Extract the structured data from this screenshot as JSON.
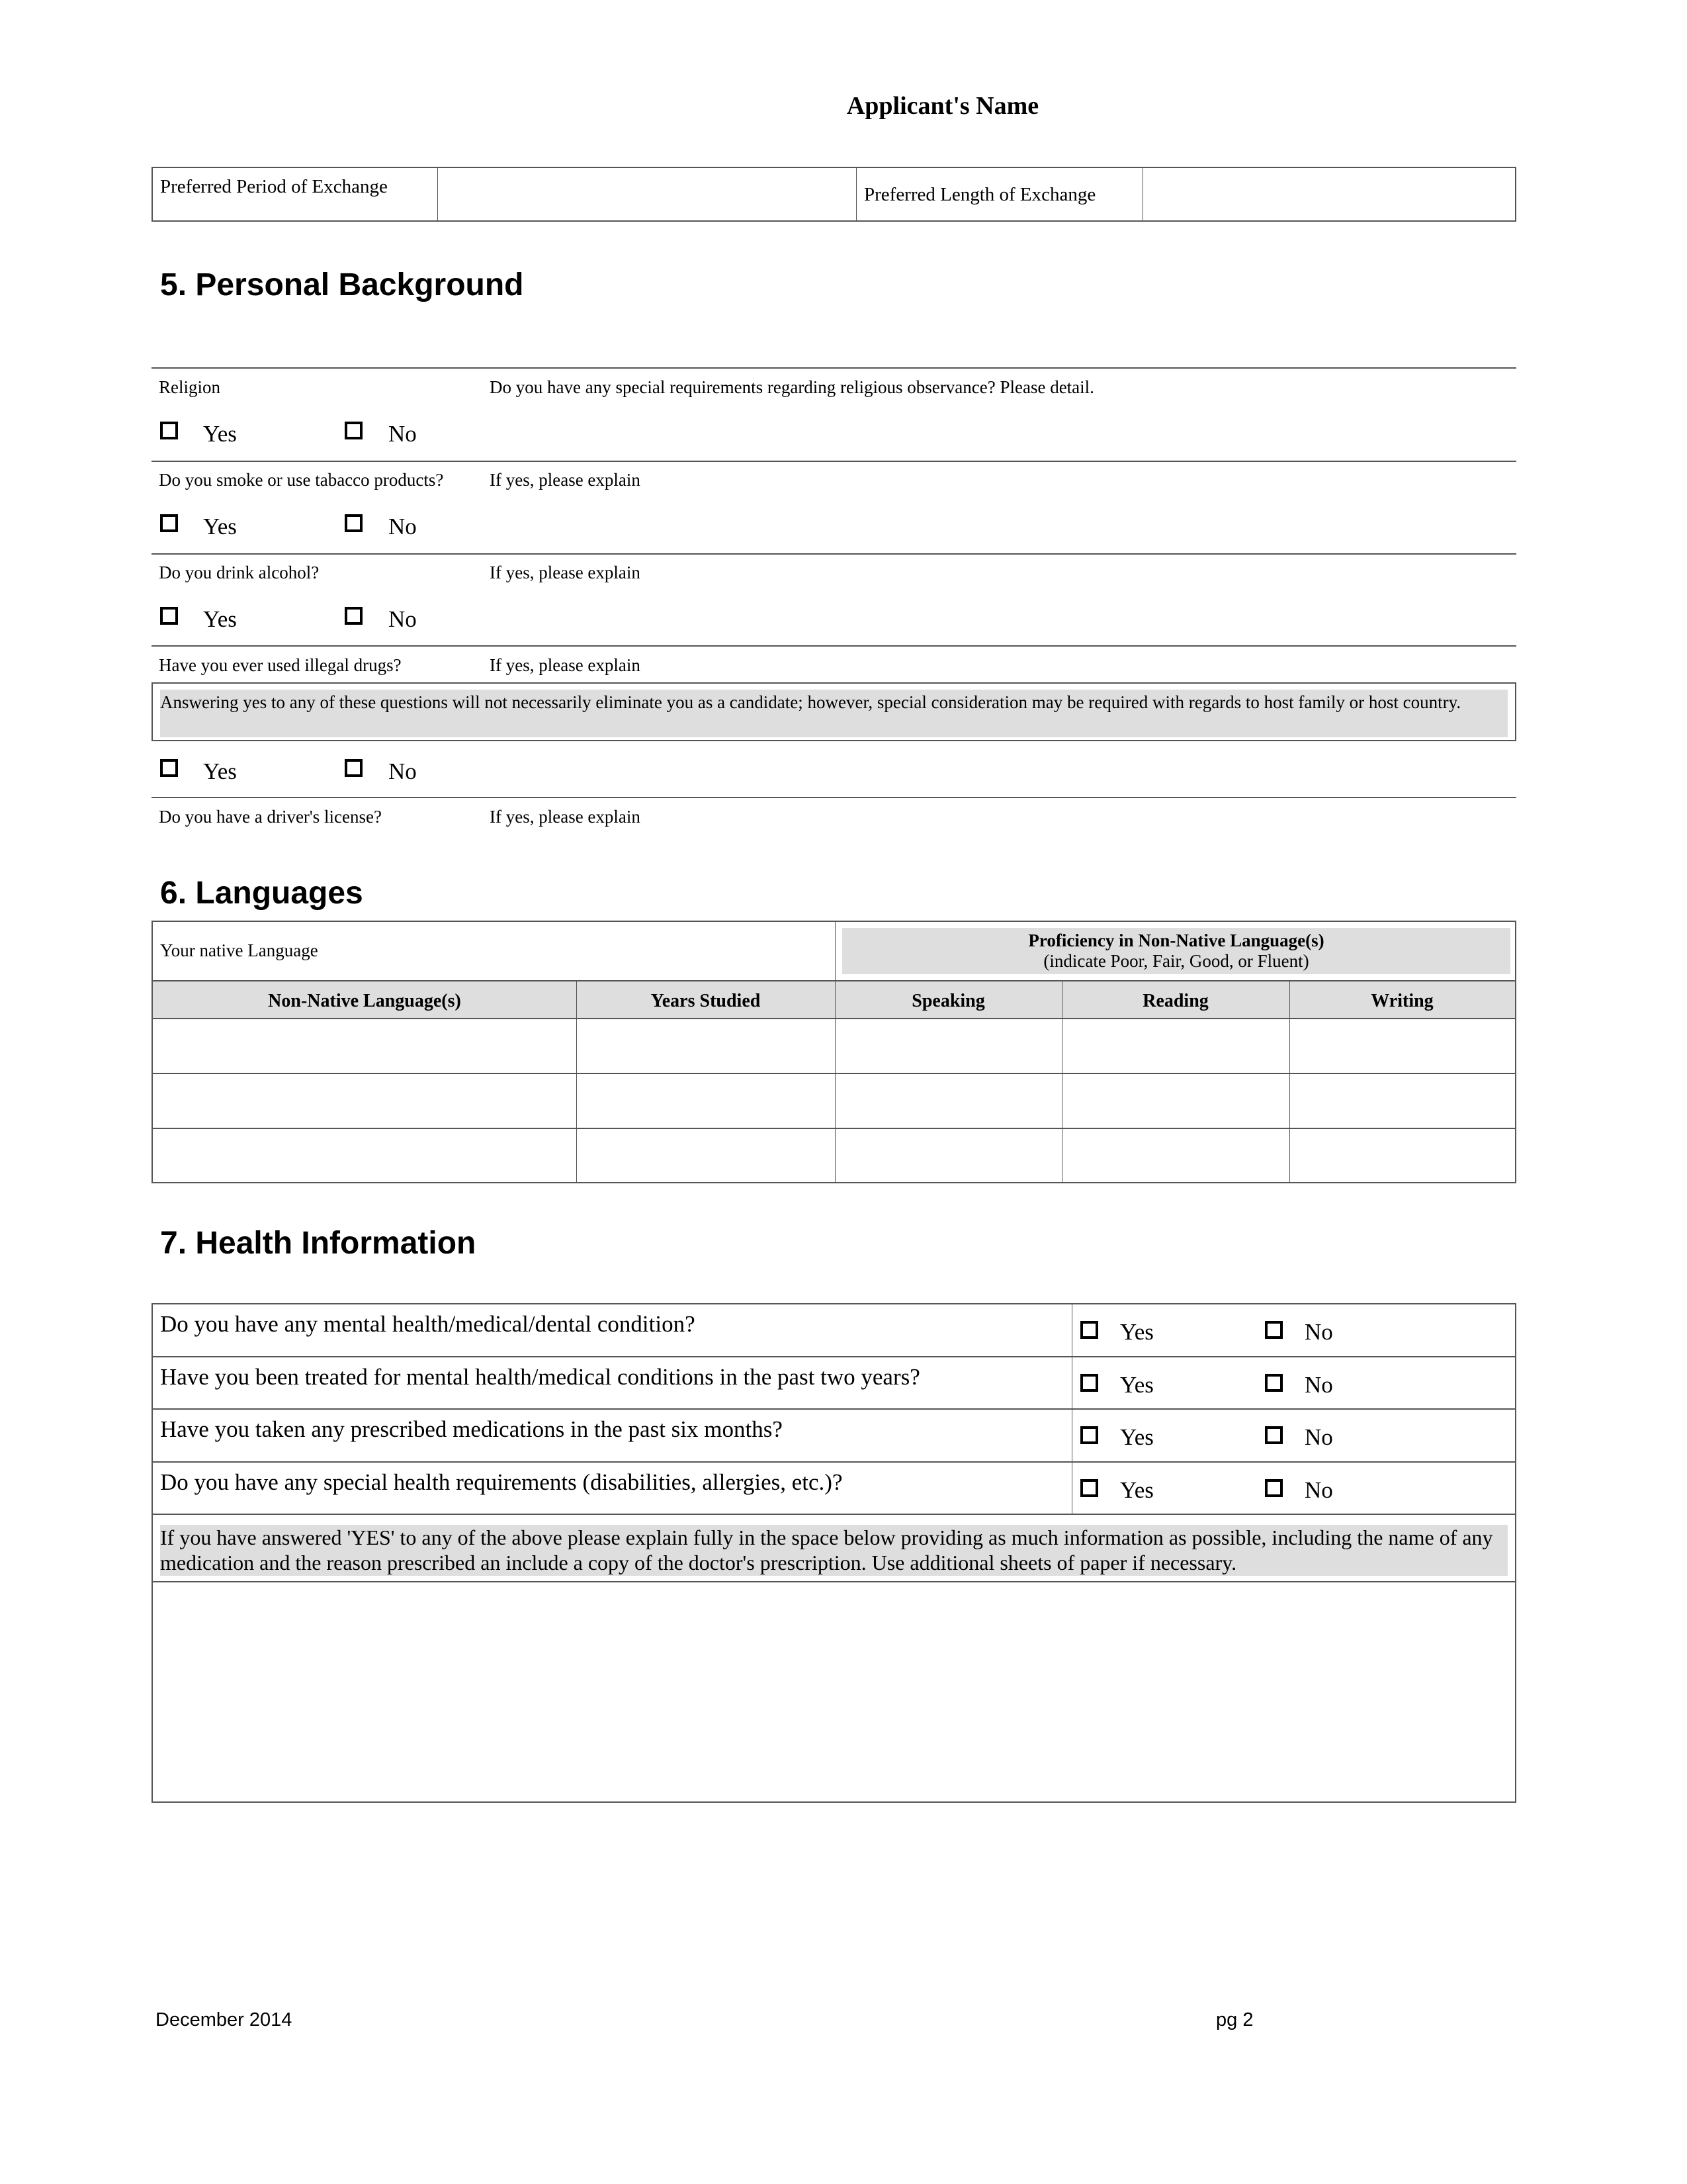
{
  "header": {
    "applicant_name_label": "Applicant's Name"
  },
  "exchange": {
    "period_label": "Preferred Period of Exchange",
    "period_value": "",
    "length_label": "Preferred Length of Exchange",
    "length_value": ""
  },
  "personal_background": {
    "title": "5. Personal Background",
    "yes_label": "Yes",
    "no_label": "No",
    "religion_label": "Religion",
    "religion_detail_label": "Do you have any special requirements regarding religious observance? Please detail.",
    "smoke_label": "Do you smoke or use tabacco products?",
    "smoke_explain_label": "If yes, please explain",
    "alcohol_label": "Do you drink alcohol?",
    "alcohol_explain_label": "If yes, please explain",
    "drugs_label": "Have you ever used illegal drugs?",
    "drugs_explain_label": "If yes, please explain",
    "notice": "Answering yes to any of these questions will not necessarily eliminate you as a candidate; however, special consideration may be required with regards to host family or host country.",
    "license_label": "Do you have a driver's license?",
    "license_explain_label": "If yes, please explain"
  },
  "languages": {
    "title": "6. Languages",
    "native_label": "Your native Language",
    "native_value": "",
    "proficiency_title": "Proficiency in Non-Native Language(s)",
    "proficiency_subtitle": "(indicate Poor, Fair, Good, or Fluent)",
    "columns": [
      "Non-Native Language(s)",
      "Years Studied",
      "Speaking",
      "Reading",
      "Writing"
    ],
    "rows": [
      [
        "",
        "",
        "",
        "",
        ""
      ],
      [
        "",
        "",
        "",
        "",
        ""
      ],
      [
        "",
        "",
        "",
        "",
        ""
      ]
    ]
  },
  "health": {
    "title": "7. Health Information",
    "yes_label": "Yes",
    "no_label": "No",
    "questions": [
      "Do you have any mental health/medical/dental condition?",
      "Have you been treated for mental health/medical conditions in the past two years?",
      "Have you taken any prescribed medications in the past six months?",
      "Do you have any special health requirements (disabilities, allergies, etc.)?"
    ],
    "notice": "If you have answered 'YES' to any of the above please explain fully in the space below providing as much information as possible, including the name of any medication and the reason prescribed an include a copy of the doctor's prescription. Use additional sheets of paper if necessary.",
    "explanation_value": ""
  },
  "footer": {
    "date": "December 2014",
    "page": "pg 2"
  }
}
